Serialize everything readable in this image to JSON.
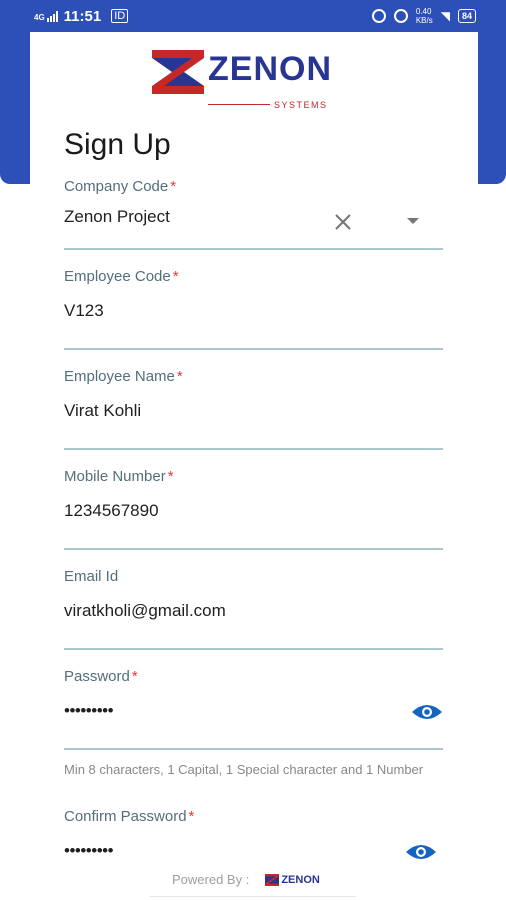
{
  "status_bar": {
    "network": "4G",
    "time": "11:51",
    "sim_label": "ID",
    "speed": "0.40",
    "speed_unit": "KB/s",
    "battery": "84"
  },
  "logo": {
    "name": "ZENON",
    "subtitle": "SYSTEMS"
  },
  "page": {
    "title": "Sign Up"
  },
  "form": {
    "company_code": {
      "label": "Company Code",
      "required": "*",
      "value": "Zenon Project"
    },
    "employee_code": {
      "label": "Employee Code",
      "required": "*",
      "value": "V123"
    },
    "employee_name": {
      "label": "Employee Name",
      "required": "*",
      "value": "Virat Kohli"
    },
    "mobile_number": {
      "label": "Mobile Number",
      "required": "*",
      "value": "1234567890"
    },
    "email": {
      "label": "Email Id",
      "value": "viratkholi@gmail.com"
    },
    "password": {
      "label": "Password",
      "required": "*",
      "value": "•••••••••",
      "hint": "Min 8 characters, 1 Capital, 1 Special character and 1 Number"
    },
    "confirm_password": {
      "label": "Confirm Password",
      "required": "*",
      "value": "•••••••••"
    }
  },
  "footer": {
    "powered_by": "Powered By :",
    "brand": "ZENON"
  },
  "colors": {
    "brand_blue": "#2c50b8",
    "logo_navy": "#283593",
    "logo_red": "#c62828",
    "eye_blue": "#1565c0",
    "underline": "#a9c8cd",
    "required": "#e53935"
  }
}
